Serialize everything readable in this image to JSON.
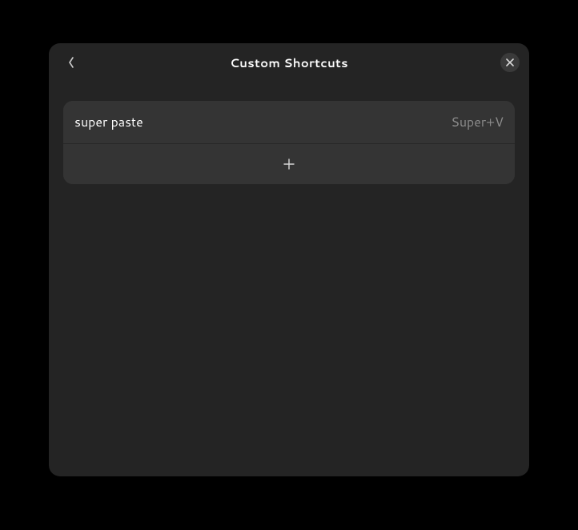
{
  "header": {
    "title": "Custom Shortcuts"
  },
  "shortcuts": [
    {
      "name": "super paste",
      "keys": "Super+V"
    }
  ],
  "icons": {
    "back": "back-icon",
    "close": "close-icon",
    "add": "plus-icon"
  }
}
